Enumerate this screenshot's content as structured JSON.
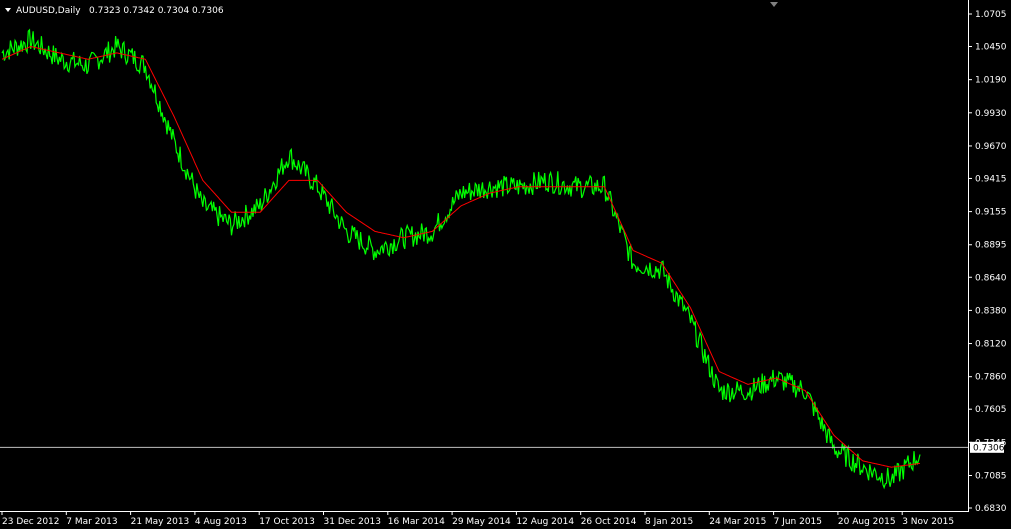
{
  "header": {
    "symbol": "AUDUSD,Daily",
    "ohlc": "0.7323 0.7342 0.7304 0.7306"
  },
  "colors": {
    "background": "#000000",
    "price": "#00ff00",
    "ma": "#ff0000",
    "axis": "#ffffff",
    "grid_line": "#c0c0c0",
    "price_box": "#ffffff"
  },
  "icons": {
    "menu": "triangle-down-icon",
    "shift": "triangle-down-icon"
  },
  "chart_data": {
    "type": "line",
    "x": [
      "23 Dec 2012",
      "7 Mar 2013",
      "21 May 2013",
      "4 Aug 2013",
      "17 Oct 2013",
      "31 Dec 2013",
      "16 Mar 2014",
      "29 May 2014",
      "12 Aug 2014",
      "26 Oct 2014",
      "8 Jan 2015",
      "24 Mar 2015",
      "7 Jun 2015",
      "20 Aug 2015",
      "3 Nov 2015"
    ],
    "x_tick_labels": [
      "23 Dec 2012",
      "7 Mar 2013",
      "21 May 2013",
      "4 Aug 2013",
      "17 Oct 2013",
      "31 Dec 2013",
      "16 Mar 2014",
      "29 May 2014",
      "12 Aug 2014",
      "26 Oct 2014",
      "8 Jan 2015",
      "24 Mar 2015",
      "7 Jun 2015",
      "20 Aug 2015",
      "3 Nov 2015"
    ],
    "y_tick_labels": [
      "1.0705",
      "1.0450",
      "1.0190",
      "0.9930",
      "0.9670",
      "0.9415",
      "0.9155",
      "0.8895",
      "0.8640",
      "0.8380",
      "0.8120",
      "0.7860",
      "0.7605",
      "0.7345",
      "0.7085",
      "0.6830"
    ],
    "ylim": [
      0.678,
      1.075
    ],
    "series": [
      {
        "values": [
          1.04,
          1.05,
          1.035,
          1.03,
          1.045,
          1.03,
          0.97,
          0.92,
          0.905,
          0.92,
          0.96,
          0.935,
          0.9,
          0.885,
          0.895,
          0.9,
          0.93,
          0.935,
          0.935,
          0.94,
          0.935,
          0.935,
          0.875,
          0.87,
          0.83,
          0.775,
          0.775,
          0.785,
          0.775,
          0.73,
          0.715,
          0.705,
          0.725
        ]
      },
      {
        "values": [
          1.035,
          1.045,
          1.04,
          1.035,
          1.04,
          1.035,
          0.99,
          0.94,
          0.915,
          0.915,
          0.94,
          0.94,
          0.915,
          0.9,
          0.895,
          0.9,
          0.92,
          0.93,
          0.935,
          0.935,
          0.935,
          0.935,
          0.885,
          0.875,
          0.84,
          0.79,
          0.78,
          0.785,
          0.775,
          0.74,
          0.72,
          0.715,
          0.718
        ]
      }
    ],
    "current_price": 0.7306,
    "current_price_label": "0.7306",
    "grid": false,
    "legend": false
  }
}
